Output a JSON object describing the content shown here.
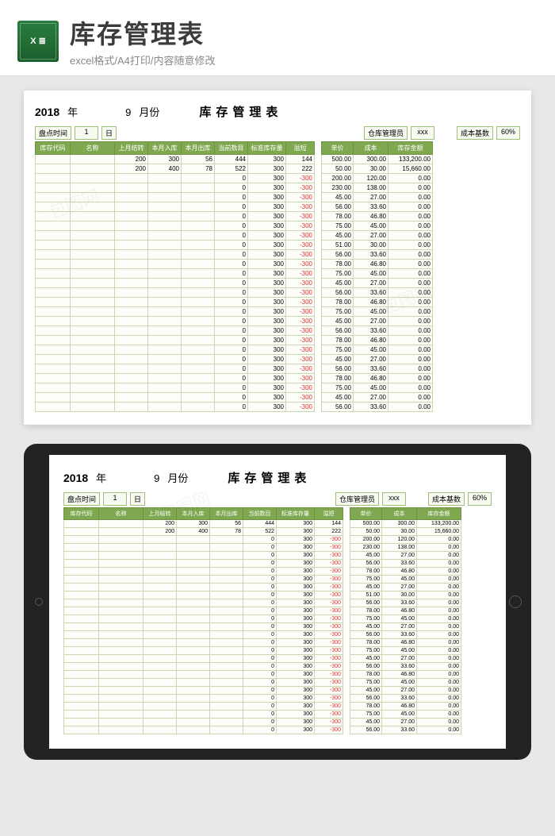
{
  "banner": {
    "icon": "X ≣",
    "title": "库存管理表",
    "subtitle": "excel格式/A4打印/内容随意修改"
  },
  "hdr": {
    "year": "2018",
    "yLbl": "年",
    "month": "9",
    "mLbl": "月份",
    "title": "库存管理表"
  },
  "meta": {
    "timeLbl": "盘点时间",
    "day": "1",
    "dayLbl": "日",
    "mgrLbl": "仓库管理员",
    "mgr": "xxx",
    "costLbl": "成本基数",
    "pct": "60%"
  },
  "colsL": [
    "库存代码",
    "名称",
    "上月结转",
    "本月入库",
    "本月出库",
    "当前数目",
    "标准库存量",
    "溢短"
  ],
  "colsR": [
    "单价",
    "成本",
    "库存金额"
  ],
  "rows": [
    {
      "l": [
        "",
        "",
        "200",
        "300",
        "56",
        "444",
        "300",
        "144"
      ],
      "r": [
        "500.00",
        "300.00",
        "133,200.00"
      ]
    },
    {
      "l": [
        "",
        "",
        "200",
        "400",
        "78",
        "522",
        "300",
        "222"
      ],
      "r": [
        "50.00",
        "30.00",
        "15,660.00"
      ]
    },
    {
      "l": [
        "",
        "",
        "",
        "",
        "",
        "0",
        "300",
        "-300"
      ],
      "r": [
        "200.00",
        "120.00",
        "0.00"
      ]
    },
    {
      "l": [
        "",
        "",
        "",
        "",
        "",
        "0",
        "300",
        "-300"
      ],
      "r": [
        "230.00",
        "138.00",
        "0.00"
      ]
    },
    {
      "l": [
        "",
        "",
        "",
        "",
        "",
        "0",
        "300",
        "-300"
      ],
      "r": [
        "45.00",
        "27.00",
        "0.00"
      ]
    },
    {
      "l": [
        "",
        "",
        "",
        "",
        "",
        "0",
        "300",
        "-300"
      ],
      "r": [
        "56.00",
        "33.60",
        "0.00"
      ]
    },
    {
      "l": [
        "",
        "",
        "",
        "",
        "",
        "0",
        "300",
        "-300"
      ],
      "r": [
        "78.00",
        "46.80",
        "0.00"
      ]
    },
    {
      "l": [
        "",
        "",
        "",
        "",
        "",
        "0",
        "300",
        "-300"
      ],
      "r": [
        "75.00",
        "45.00",
        "0.00"
      ]
    },
    {
      "l": [
        "",
        "",
        "",
        "",
        "",
        "0",
        "300",
        "-300"
      ],
      "r": [
        "45.00",
        "27.00",
        "0.00"
      ]
    },
    {
      "l": [
        "",
        "",
        "",
        "",
        "",
        "0",
        "300",
        "-300"
      ],
      "r": [
        "51.00",
        "30.00",
        "0.00"
      ]
    },
    {
      "l": [
        "",
        "",
        "",
        "",
        "",
        "0",
        "300",
        "-300"
      ],
      "r": [
        "56.00",
        "33.60",
        "0.00"
      ]
    },
    {
      "l": [
        "",
        "",
        "",
        "",
        "",
        "0",
        "300",
        "-300"
      ],
      "r": [
        "78.00",
        "46.80",
        "0.00"
      ]
    },
    {
      "l": [
        "",
        "",
        "",
        "",
        "",
        "0",
        "300",
        "-300"
      ],
      "r": [
        "75.00",
        "45.00",
        "0.00"
      ]
    },
    {
      "l": [
        "",
        "",
        "",
        "",
        "",
        "0",
        "300",
        "-300"
      ],
      "r": [
        "45.00",
        "27.00",
        "0.00"
      ]
    },
    {
      "l": [
        "",
        "",
        "",
        "",
        "",
        "0",
        "300",
        "-300"
      ],
      "r": [
        "56.00",
        "33.60",
        "0.00"
      ]
    },
    {
      "l": [
        "",
        "",
        "",
        "",
        "",
        "0",
        "300",
        "-300"
      ],
      "r": [
        "78.00",
        "46.80",
        "0.00"
      ]
    },
    {
      "l": [
        "",
        "",
        "",
        "",
        "",
        "0",
        "300",
        "-300"
      ],
      "r": [
        "75.00",
        "45.00",
        "0.00"
      ]
    },
    {
      "l": [
        "",
        "",
        "",
        "",
        "",
        "0",
        "300",
        "-300"
      ],
      "r": [
        "45.00",
        "27.00",
        "0.00"
      ]
    },
    {
      "l": [
        "",
        "",
        "",
        "",
        "",
        "0",
        "300",
        "-300"
      ],
      "r": [
        "56.00",
        "33.60",
        "0.00"
      ]
    },
    {
      "l": [
        "",
        "",
        "",
        "",
        "",
        "0",
        "300",
        "-300"
      ],
      "r": [
        "78.00",
        "46.80",
        "0.00"
      ]
    },
    {
      "l": [
        "",
        "",
        "",
        "",
        "",
        "0",
        "300",
        "-300"
      ],
      "r": [
        "75.00",
        "45.00",
        "0.00"
      ]
    },
    {
      "l": [
        "",
        "",
        "",
        "",
        "",
        "0",
        "300",
        "-300"
      ],
      "r": [
        "45.00",
        "27.00",
        "0.00"
      ]
    },
    {
      "l": [
        "",
        "",
        "",
        "",
        "",
        "0",
        "300",
        "-300"
      ],
      "r": [
        "56.00",
        "33.60",
        "0.00"
      ]
    },
    {
      "l": [
        "",
        "",
        "",
        "",
        "",
        "0",
        "300",
        "-300"
      ],
      "r": [
        "78.00",
        "46.80",
        "0.00"
      ]
    },
    {
      "l": [
        "",
        "",
        "",
        "",
        "",
        "0",
        "300",
        "-300"
      ],
      "r": [
        "75.00",
        "45.00",
        "0.00"
      ]
    },
    {
      "l": [
        "",
        "",
        "",
        "",
        "",
        "0",
        "300",
        "-300"
      ],
      "r": [
        "45.00",
        "27.00",
        "0.00"
      ]
    },
    {
      "l": [
        "",
        "",
        "",
        "",
        "",
        "0",
        "300",
        "-300"
      ],
      "r": [
        "56.00",
        "33.60",
        "0.00"
      ]
    }
  ],
  "watermark": "包图网"
}
